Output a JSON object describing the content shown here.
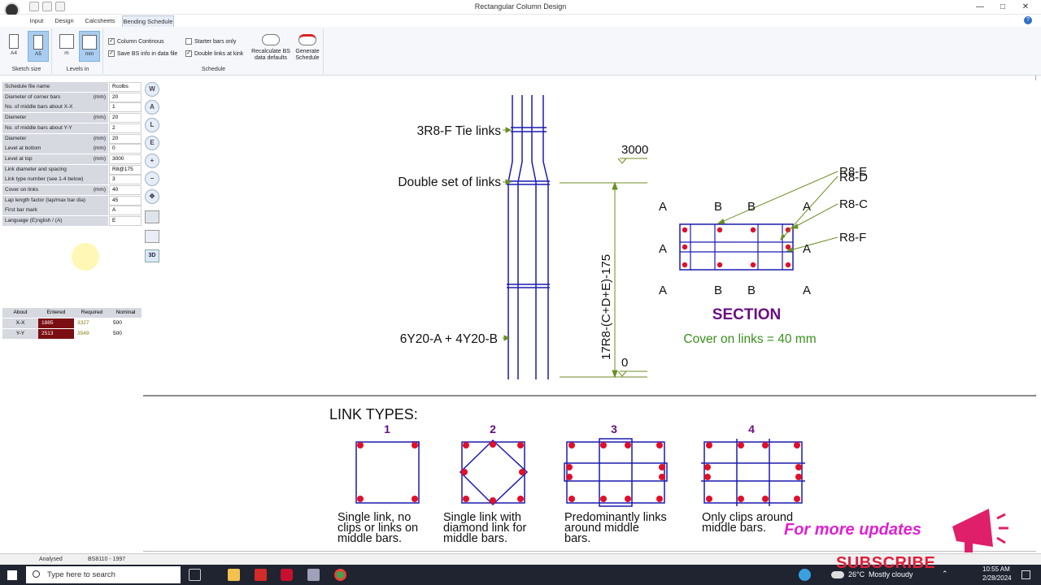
{
  "window": {
    "title": "Rectangular Column Design"
  },
  "tabs": [
    {
      "label": "Input",
      "active": false
    },
    {
      "label": "Design",
      "active": false
    },
    {
      "label": "Calcsheets",
      "active": false
    },
    {
      "label": "Bending Schedule",
      "active": true
    }
  ],
  "ribbon": {
    "sketch_size": {
      "group_label": "Sketch size",
      "a4": "A4",
      "a5": "A5",
      "selected": "A5"
    },
    "levels_in": {
      "group_label": "Levels in",
      "m": "m",
      "mm": "mm",
      "selected": "mm"
    },
    "schedule": {
      "group_label": "Schedule",
      "column_continous": {
        "label": "Column Continous",
        "checked": true
      },
      "save_bs_info": {
        "label": "Save BS info in data file",
        "checked": true
      },
      "starter_bars_only": {
        "label": "Starter bars only",
        "checked": false
      },
      "double_links_at_kink": {
        "label": "Double links at kink",
        "checked": true
      },
      "recalculate_label": "Recalculate BS data defaults",
      "recalculate_l1": "Recalculate BS",
      "recalculate_l2": "data defaults",
      "generate_l1": "Generate",
      "generate_l2": "Schedule"
    }
  },
  "params": [
    {
      "label": "Schedule file name",
      "unit": "",
      "value": "Rcolbs"
    },
    {
      "label": "Diameter of corner bars",
      "unit": "(mm)",
      "value": "20"
    },
    {
      "label": "No. of middle bars about X-X",
      "unit": "",
      "value": "1"
    },
    {
      "label": "Diameter",
      "unit": "(mm)",
      "value": "20"
    },
    {
      "label": "No. of middle bars about Y-Y",
      "unit": "",
      "value": "2"
    },
    {
      "label": "Diameter",
      "unit": "(mm)",
      "value": "20"
    },
    {
      "label": "Level at bottom",
      "unit": "(mm)",
      "value": "0"
    },
    {
      "label": "Level at top",
      "unit": "(mm)",
      "value": "3000"
    },
    {
      "label": "Link diameter and spacing",
      "unit": "",
      "value": "R8@175"
    },
    {
      "label": "Link type number (see 1-4 below)",
      "unit": "",
      "value": "3"
    },
    {
      "label": "Cover on links",
      "unit": "(mm)",
      "value": "40"
    },
    {
      "label": "Lap length factor (lap/max bar dia)",
      "unit": "",
      "value": "45"
    },
    {
      "label": "First bar mark",
      "unit": "",
      "value": "A"
    },
    {
      "label": "Language (E)nglish / (A)",
      "unit": "",
      "value": "E"
    }
  ],
  "bars_table": {
    "headers": [
      "About",
      "Entered",
      "Required",
      "Nominal"
    ],
    "rows": [
      {
        "about": "X-X",
        "entered": "1885",
        "required": "3327",
        "nominal": "500"
      },
      {
        "about": "Y-Y",
        "entered": "2513",
        "required": "3549",
        "nominal": "500"
      }
    ]
  },
  "tools": [
    "W",
    "A",
    "L",
    "E",
    "+",
    "−",
    "✥"
  ],
  "tool_3d": "3D",
  "sketch": {
    "tie_links": "3R8-F Tie links",
    "double_links": "Double set of links",
    "main_bars": "6Y20-A + 4Y20-B",
    "links_dim": "17R8-(C+D+E)-175",
    "level_top": "3000",
    "level_bottom": "0",
    "section_title": "SECTION",
    "cover_note": "Cover on links = 40 mm",
    "bar_a": "A",
    "bar_b": "B",
    "link_e": "R8-E",
    "link_d": "R8-D",
    "link_c": "R8-C",
    "link_f": "R8-F"
  },
  "link_types": {
    "title": "LINK TYPES:",
    "items": [
      {
        "number": "1",
        "line1": "Single link, no",
        "line2": "clips or links on",
        "line3": "middle bars."
      },
      {
        "number": "2",
        "line1": "Single link with",
        "line2": "diamond link for",
        "line3": "middle bars."
      },
      {
        "number": "3",
        "line1": "Predominantly links",
        "line2": "around middle",
        "line3": "bars."
      },
      {
        "number": "4",
        "line1": "Only clips around",
        "line2": "middle bars.",
        "line3": ""
      }
    ]
  },
  "overlay": {
    "updates": "For more updates",
    "subscribe": "SUBSCRIBE"
  },
  "status": {
    "state": "Analysed",
    "code": "BS8110 - 1997"
  },
  "taskbar": {
    "search_placeholder": "Type here to search",
    "temperature": "26°C",
    "weather": "Mostly cloudy",
    "time": "10:55 AM",
    "date": "2/28/2024"
  },
  "colors": {
    "bar_dot": "#e0102a",
    "steel_line": "#1a1ab0",
    "dimension": "#6b8e23",
    "title_purple": "#6a0d83",
    "cover_green": "#3b8f1e",
    "entered_bg": "#7a0e12"
  }
}
